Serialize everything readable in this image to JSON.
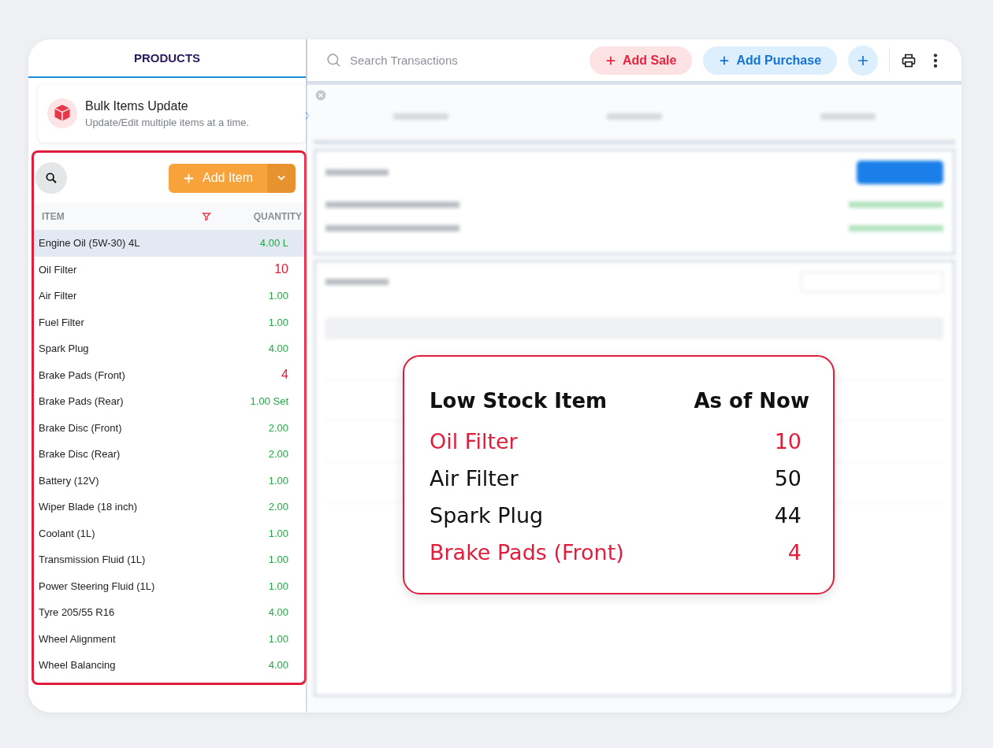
{
  "sidebar": {
    "tab": {
      "label": "PRODUCTS",
      "selected": true
    },
    "bulk_update": {
      "title": "Bulk Items Update",
      "subtitle": "Update/Edit multiple items at a time."
    },
    "add_item_button": {
      "label": "Add Item"
    },
    "columns": [
      {
        "label": "ITEM"
      },
      {
        "label": "QUANTITY"
      }
    ],
    "items": [
      {
        "name": "Engine Oil (5W-30) 4L",
        "quantity": "4.00 L",
        "low_stock": false,
        "selected": true
      },
      {
        "name": "Oil Filter",
        "quantity": "10",
        "low_stock": true,
        "selected": false
      },
      {
        "name": "Air Filter",
        "quantity": "1.00",
        "low_stock": false,
        "selected": false
      },
      {
        "name": "Fuel Filter",
        "quantity": "1.00",
        "low_stock": false,
        "selected": false
      },
      {
        "name": "Spark Plug",
        "quantity": "4.00",
        "low_stock": false,
        "selected": false
      },
      {
        "name": "Brake Pads (Front)",
        "quantity": "4",
        "low_stock": true,
        "selected": false
      },
      {
        "name": "Brake Pads (Rear)",
        "quantity": "1.00 Set",
        "low_stock": false,
        "selected": false
      },
      {
        "name": "Brake Disc (Front)",
        "quantity": "2.00",
        "low_stock": false,
        "selected": false
      },
      {
        "name": "Brake Disc (Rear)",
        "quantity": "2.00",
        "low_stock": false,
        "selected": false
      },
      {
        "name": "Battery (12V)",
        "quantity": "1.00",
        "low_stock": false,
        "selected": false
      },
      {
        "name": "Wiper Blade (18 inch)",
        "quantity": "2.00",
        "low_stock": false,
        "selected": false
      },
      {
        "name": "Coolant (1L)",
        "quantity": "1.00",
        "low_stock": false,
        "selected": false
      },
      {
        "name": "Transmission Fluid (1L)",
        "quantity": "1.00",
        "low_stock": false,
        "selected": false
      },
      {
        "name": "Power Steering Fluid (1L)",
        "quantity": "1.00",
        "low_stock": false,
        "selected": false
      },
      {
        "name": "Tyre 205/55 R16",
        "quantity": "4.00",
        "low_stock": false,
        "selected": false
      },
      {
        "name": "Wheel Alignment",
        "quantity": "1.00",
        "low_stock": false,
        "selected": false
      },
      {
        "name": "Wheel Balancing",
        "quantity": "4.00",
        "low_stock": false,
        "selected": false
      }
    ]
  },
  "toolbar": {
    "search": {
      "placeholder": "Search Transactions"
    },
    "buttons": [
      {
        "label": "Add Sale",
        "kind": "sale"
      },
      {
        "label": "Add Purchase",
        "kind": "purchase"
      }
    ]
  },
  "low_stock_popup": {
    "columns": [
      "Low Stock Item",
      "As of Now"
    ],
    "rows": [
      {
        "name": "Oil Filter",
        "value": "10",
        "low_stock": true
      },
      {
        "name": "Air Filter",
        "value": "50",
        "low_stock": false
      },
      {
        "name": "Spark Plug",
        "value": "44",
        "low_stock": false
      },
      {
        "name": "Brake Pads (Front)",
        "value": "4",
        "low_stock": true
      }
    ]
  }
}
